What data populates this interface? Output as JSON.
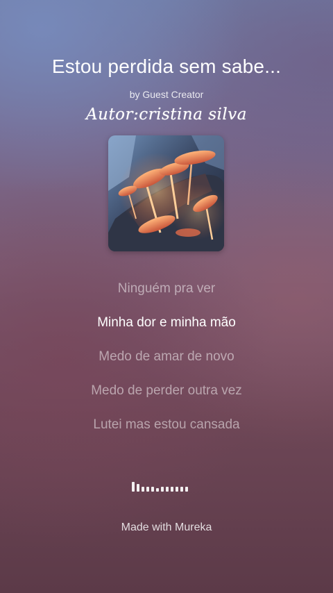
{
  "song": {
    "title": "Estou perdida sem sabe...",
    "byline": "by Guest Creator",
    "author": "Autor:cristina silva"
  },
  "cover": {
    "icon": "mushroom-artwork"
  },
  "lyrics": [
    {
      "text": "Ninguém pra ver",
      "active": false
    },
    {
      "text": "Minha dor e minha mão",
      "active": true
    },
    {
      "text": "Medo de amar de novo",
      "active": false
    },
    {
      "text": "Medo de perder outra vez",
      "active": false
    },
    {
      "text": "Lutei mas estou cansada",
      "active": false
    }
  ],
  "visualizer": {
    "levels": [
      1.0,
      0.75,
      0.5,
      0.5,
      0.5,
      0.35,
      0.5,
      0.5,
      0.5,
      0.5,
      0.5,
      0.5
    ]
  },
  "footer": {
    "text": "Made with Mureka"
  }
}
